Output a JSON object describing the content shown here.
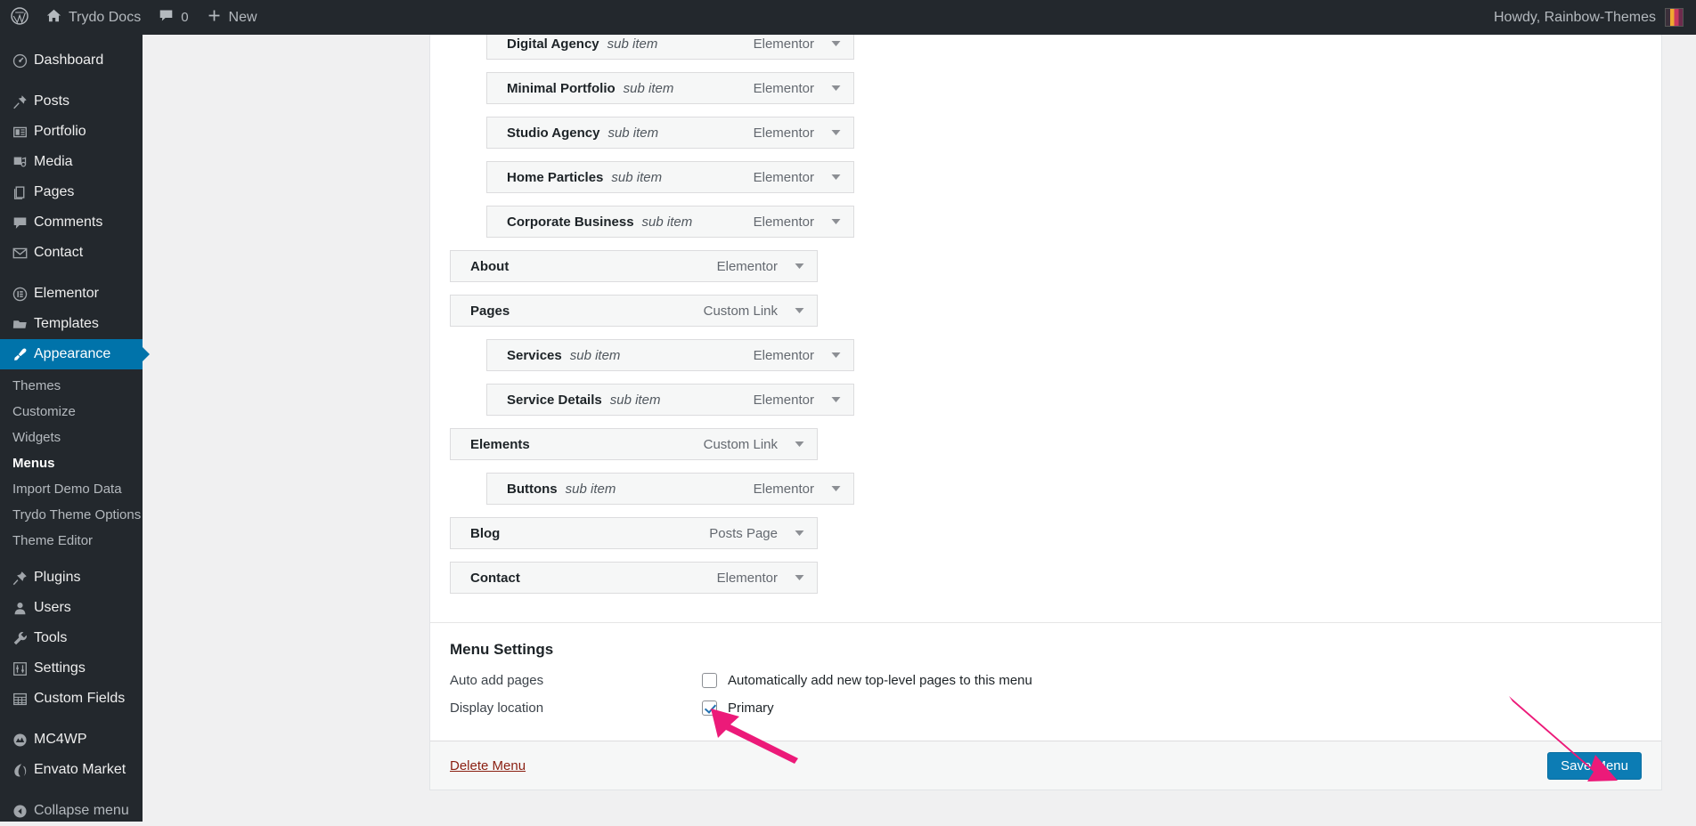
{
  "adminbar": {
    "logo_icon": "wordpress-logo-icon",
    "site_icon": "home-icon",
    "site_name": "Trydo Docs",
    "comments_icon": "comment-icon",
    "comments_count": "0",
    "new_icon": "plus-icon",
    "new_label": "New",
    "howdy": "Howdy, Rainbow-Themes",
    "avatar_icon": "user-avatar"
  },
  "sidebar": {
    "items": [
      {
        "label": "Dashboard",
        "icon": "dashboard-icon",
        "current": false,
        "sep_after": true
      },
      {
        "label": "Posts",
        "icon": "pin-icon",
        "current": false,
        "sep_after": false
      },
      {
        "label": "Portfolio",
        "icon": "portfolio-icon",
        "current": false,
        "sep_after": false
      },
      {
        "label": "Media",
        "icon": "media-icon",
        "current": false,
        "sep_after": false
      },
      {
        "label": "Pages",
        "icon": "pages-icon",
        "current": false,
        "sep_after": false
      },
      {
        "label": "Comments",
        "icon": "comment-icon",
        "current": false,
        "sep_after": false
      },
      {
        "label": "Contact",
        "icon": "envelope-icon",
        "current": false,
        "sep_after": true
      },
      {
        "label": "Elementor",
        "icon": "elementor-icon",
        "current": false,
        "sep_after": false
      },
      {
        "label": "Templates",
        "icon": "folder-icon",
        "current": false,
        "sep_after": false
      },
      {
        "label": "Appearance",
        "icon": "paintbrush-icon",
        "current": true,
        "sep_after": false
      }
    ],
    "submenu": [
      {
        "label": "Themes",
        "current": false
      },
      {
        "label": "Customize",
        "current": false
      },
      {
        "label": "Widgets",
        "current": false
      },
      {
        "label": "Menus",
        "current": true
      },
      {
        "label": "Import Demo Data",
        "current": false
      },
      {
        "label": "Trydo Theme Options",
        "current": false
      },
      {
        "label": "Theme Editor",
        "current": false
      }
    ],
    "items_lower": [
      {
        "label": "Plugins",
        "icon": "plug-icon",
        "sep_after": false
      },
      {
        "label": "Users",
        "icon": "user-icon",
        "sep_after": false
      },
      {
        "label": "Tools",
        "icon": "wrench-icon",
        "sep_after": false
      },
      {
        "label": "Settings",
        "icon": "settings-icon",
        "sep_after": false
      },
      {
        "label": "Custom Fields",
        "icon": "table-icon",
        "sep_after": true
      },
      {
        "label": "MC4WP",
        "icon": "mailchimp-icon",
        "sep_after": false
      },
      {
        "label": "Envato Market",
        "icon": "envato-icon",
        "sep_after": false
      }
    ],
    "collapse": {
      "label": "Collapse menu",
      "icon": "collapse-arrow-icon"
    }
  },
  "menu_items": [
    {
      "title": "Digital Agency",
      "sublabel": "sub item",
      "type": "Elementor",
      "depth": 1
    },
    {
      "title": "Minimal Portfolio",
      "sublabel": "sub item",
      "type": "Elementor",
      "depth": 1
    },
    {
      "title": "Studio Agency",
      "sublabel": "sub item",
      "type": "Elementor",
      "depth": 1
    },
    {
      "title": "Home Particles",
      "sublabel": "sub item",
      "type": "Elementor",
      "depth": 1
    },
    {
      "title": "Corporate Business",
      "sublabel": "sub item",
      "type": "Elementor",
      "depth": 1
    },
    {
      "title": "About",
      "sublabel": "",
      "type": "Elementor",
      "depth": 0
    },
    {
      "title": "Pages",
      "sublabel": "",
      "type": "Custom Link",
      "depth": 0
    },
    {
      "title": "Services",
      "sublabel": "sub item",
      "type": "Elementor",
      "depth": 1
    },
    {
      "title": "Service Details",
      "sublabel": "sub item",
      "type": "Elementor",
      "depth": 1
    },
    {
      "title": "Elements",
      "sublabel": "",
      "type": "Custom Link",
      "depth": 0
    },
    {
      "title": "Buttons",
      "sublabel": "sub item",
      "type": "Elementor",
      "depth": 1
    },
    {
      "title": "Blog",
      "sublabel": "",
      "type": "Posts Page",
      "depth": 0
    },
    {
      "title": "Contact",
      "sublabel": "",
      "type": "Elementor",
      "depth": 0
    }
  ],
  "menu_settings": {
    "heading": "Menu Settings",
    "auto_add_label": "Auto add pages",
    "auto_add_checkbox_text": "Automatically add new top-level pages to this menu",
    "auto_add_checked": false,
    "display_location_label": "Display location",
    "display_location_option": "Primary",
    "display_location_checked": true
  },
  "footer": {
    "delete_label": "Delete Menu",
    "save_label": "Save Menu"
  },
  "annotations": {
    "arrow_color": "#ec1a79",
    "arrow_primary_target": "primary-checkbox",
    "arrow_save_target": "save-menu-button"
  },
  "colors": {
    "admin_bar": "#23282d",
    "sidebar": "#23282d",
    "active_blue": "#0073aa",
    "save_button": "#0c7cb4",
    "delete_link": "#8a1f11",
    "arrow_pink": "#ec1a79"
  }
}
